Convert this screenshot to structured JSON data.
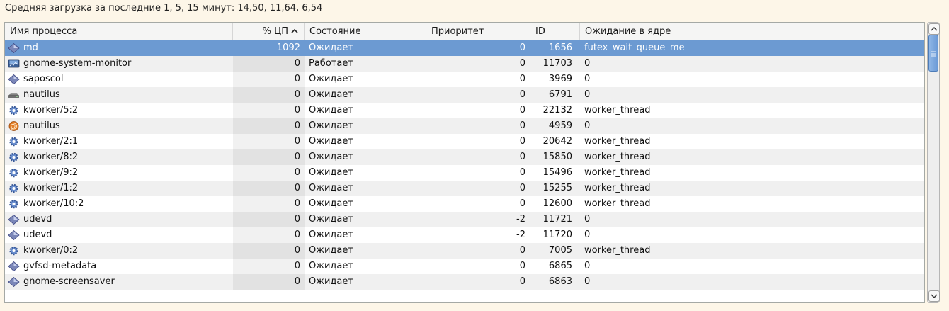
{
  "load_average_text": "Средняя загрузка за последние 1, 5, 15 минут: 14,50, 11,64, 6,54",
  "columns": {
    "name": "Имя процесса",
    "cpu": "% ЦП",
    "state": "Состояние",
    "priority": "Приоритет",
    "id": "ID",
    "wait": "Ожидание в ядре"
  },
  "sort": {
    "column": "cpu",
    "direction": "descending",
    "icon": "chevron-up-icon"
  },
  "selected_index": 0,
  "processes": [
    {
      "name": "md",
      "cpu": "1092",
      "state": "Ожидает",
      "priority": "0",
      "id": "1656",
      "wait": "futex_wait_queue_me",
      "icon": "diamond-icon"
    },
    {
      "name": "gnome-system-monitor",
      "cpu": "0",
      "state": "Работает",
      "priority": "0",
      "id": "11703",
      "wait": "0",
      "icon": "monitor-icon"
    },
    {
      "name": "saposcol",
      "cpu": "0",
      "state": "Ожидает",
      "priority": "0",
      "id": "3969",
      "wait": "0",
      "icon": "diamond-icon"
    },
    {
      "name": "nautilus",
      "cpu": "0",
      "state": "Ожидает",
      "priority": "0",
      "id": "6791",
      "wait": "0",
      "icon": "drive-icon"
    },
    {
      "name": "kworker/5:2",
      "cpu": "0",
      "state": "Ожидает",
      "priority": "0",
      "id": "22132",
      "wait": "worker_thread",
      "icon": "gear-icon"
    },
    {
      "name": "nautilus",
      "cpu": "0",
      "state": "Ожидает",
      "priority": "0",
      "id": "4959",
      "wait": "0",
      "icon": "shell-icon"
    },
    {
      "name": "kworker/2:1",
      "cpu": "0",
      "state": "Ожидает",
      "priority": "0",
      "id": "20642",
      "wait": "worker_thread",
      "icon": "gear-icon"
    },
    {
      "name": "kworker/8:2",
      "cpu": "0",
      "state": "Ожидает",
      "priority": "0",
      "id": "15850",
      "wait": "worker_thread",
      "icon": "gear-icon"
    },
    {
      "name": "kworker/9:2",
      "cpu": "0",
      "state": "Ожидает",
      "priority": "0",
      "id": "15496",
      "wait": "worker_thread",
      "icon": "gear-icon"
    },
    {
      "name": "kworker/1:2",
      "cpu": "0",
      "state": "Ожидает",
      "priority": "0",
      "id": "15255",
      "wait": "worker_thread",
      "icon": "gear-icon"
    },
    {
      "name": "kworker/10:2",
      "cpu": "0",
      "state": "Ожидает",
      "priority": "0",
      "id": "12600",
      "wait": "worker_thread",
      "icon": "gear-icon"
    },
    {
      "name": "udevd",
      "cpu": "0",
      "state": "Ожидает",
      "priority": "-2",
      "id": "11721",
      "wait": "0",
      "icon": "diamond-icon"
    },
    {
      "name": "udevd",
      "cpu": "0",
      "state": "Ожидает",
      "priority": "-2",
      "id": "11720",
      "wait": "0",
      "icon": "diamond-icon"
    },
    {
      "name": "kworker/0:2",
      "cpu": "0",
      "state": "Ожидает",
      "priority": "0",
      "id": "7005",
      "wait": "worker_thread",
      "icon": "gear-icon"
    },
    {
      "name": "gvfsd-metadata",
      "cpu": "0",
      "state": "Ожидает",
      "priority": "0",
      "id": "6865",
      "wait": "0",
      "icon": "diamond-icon"
    },
    {
      "name": "gnome-screensaver",
      "cpu": "0",
      "state": "Ожидает",
      "priority": "0",
      "id": "6863",
      "wait": "0",
      "icon": "diamond-icon"
    }
  ],
  "colors": {
    "selection": "#6c9ad2",
    "background": "#fdf6e8",
    "alt_row": "#f0f0f0"
  }
}
